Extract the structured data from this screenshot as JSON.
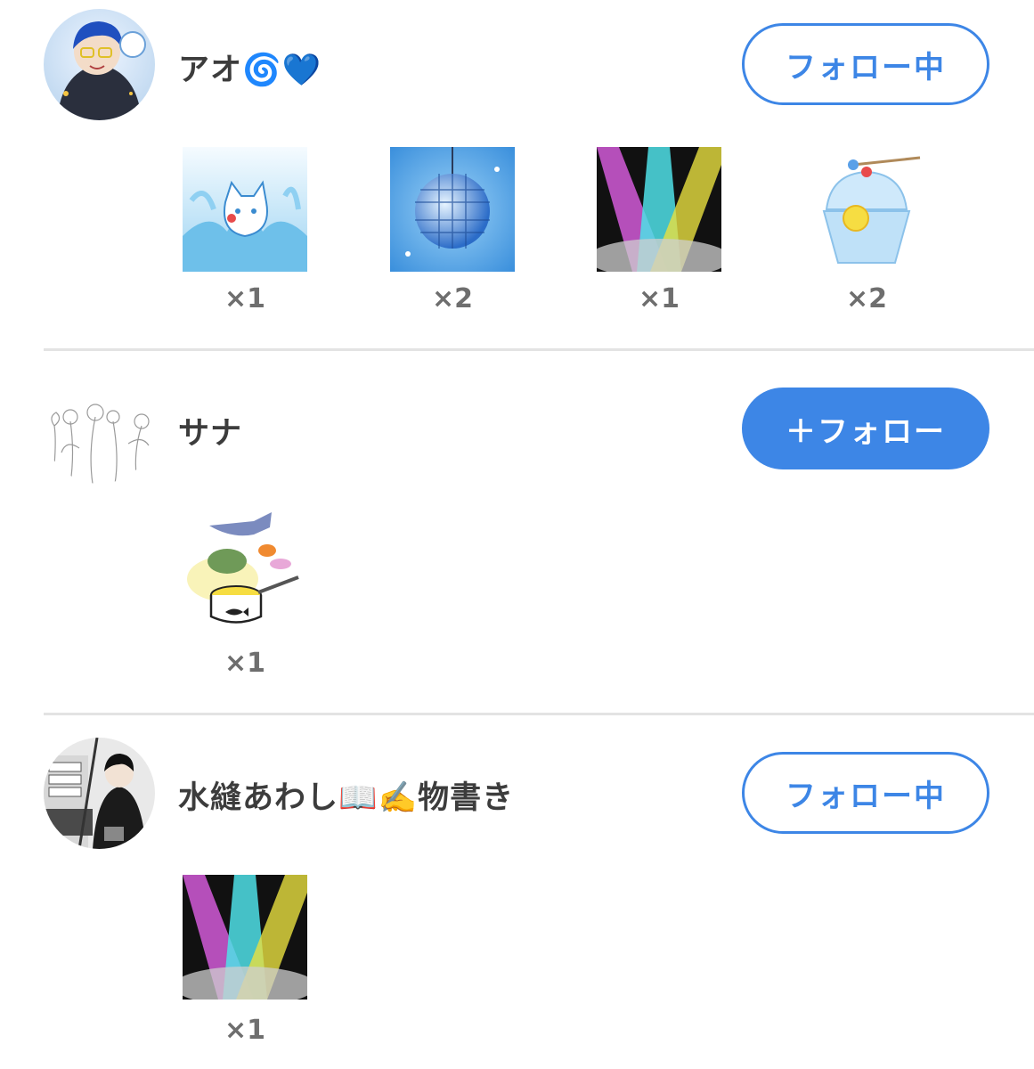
{
  "users": [
    {
      "name": "アオ🌀💙",
      "follow_label": "フォロー中",
      "gifts": [
        {
          "icon": "cat-splash-icon",
          "count": "×1"
        },
        {
          "icon": "disco-ball-icon",
          "count": "×2"
        },
        {
          "icon": "spotlights-icon",
          "count": "×1"
        },
        {
          "icon": "shaved-ice-icon",
          "count": "×2"
        }
      ]
    },
    {
      "name": "サナ",
      "follow_label": "＋フォロー",
      "gifts": [
        {
          "icon": "fish-can-icon",
          "count": "×1"
        }
      ]
    },
    {
      "name": "水縫あわし📖✍️物書き",
      "follow_label": "フォロー中",
      "gifts": [
        {
          "icon": "spotlights-icon",
          "count": "×1"
        }
      ]
    }
  ],
  "colors": {
    "accent": "#3d86e6",
    "name_text": "#3c3c3c",
    "count_text": "#6e6e6e",
    "divider": "#e3e3e3"
  }
}
